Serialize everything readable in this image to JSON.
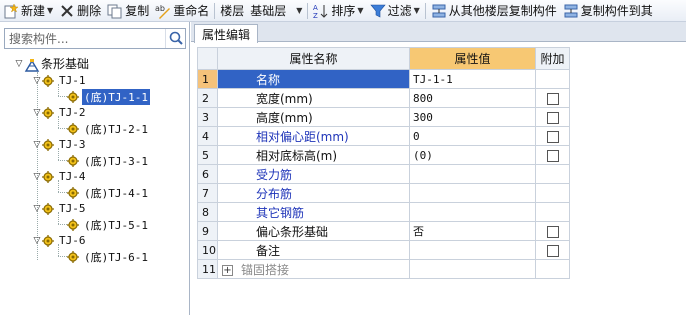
{
  "toolbar": {
    "new_label": "新建",
    "delete_label": "删除",
    "copy_label": "复制",
    "rename_label": "重命名",
    "floor_label": "楼层",
    "floor_value": "基础层",
    "sort_label": "排序",
    "filter_label": "过滤",
    "copy_from_floor_label": "从其他楼层复制构件",
    "copy_to_floor_label": "复制构件到其"
  },
  "search": {
    "placeholder": "搜索构件..."
  },
  "tree": {
    "root": "条形基础",
    "groups": [
      {
        "name": "TJ-1",
        "child": "(底)TJ-1-1"
      },
      {
        "name": "TJ-2",
        "child": "(底)TJ-2-1"
      },
      {
        "name": "TJ-3",
        "child": "(底)TJ-3-1"
      },
      {
        "name": "TJ-4",
        "child": "(底)TJ-4-1"
      },
      {
        "name": "TJ-5",
        "child": "(底)TJ-5-1"
      },
      {
        "name": "TJ-6",
        "child": "(底)TJ-6-1"
      }
    ]
  },
  "properties": {
    "tab_label": "属性编辑",
    "headers": {
      "name": "属性名称",
      "value": "属性值",
      "attach": "附加"
    },
    "rows": [
      {
        "index": "1",
        "name": "名称",
        "value": "TJ-1-1"
      },
      {
        "index": "2",
        "name": "宽度(mm)",
        "value": "800"
      },
      {
        "index": "3",
        "name": "高度(mm)",
        "value": "300"
      },
      {
        "index": "4",
        "name": "相对偏心距(mm)",
        "value": "0"
      },
      {
        "index": "5",
        "name": "相对底标高(m)",
        "value": "(0)"
      },
      {
        "index": "6",
        "name": "受力筋",
        "value": ""
      },
      {
        "index": "7",
        "name": "分布筋",
        "value": ""
      },
      {
        "index": "8",
        "name": "其它钢筋",
        "value": ""
      },
      {
        "index": "9",
        "name": "偏心条形基础",
        "value": "否"
      },
      {
        "index": "10",
        "name": "备注",
        "value": ""
      },
      {
        "index": "11",
        "name": "锚固搭接",
        "value": ""
      }
    ]
  },
  "colors": {
    "selection": "#3163c5",
    "header_highlight": "#f7c873",
    "blue_text": "#1f35b9"
  }
}
